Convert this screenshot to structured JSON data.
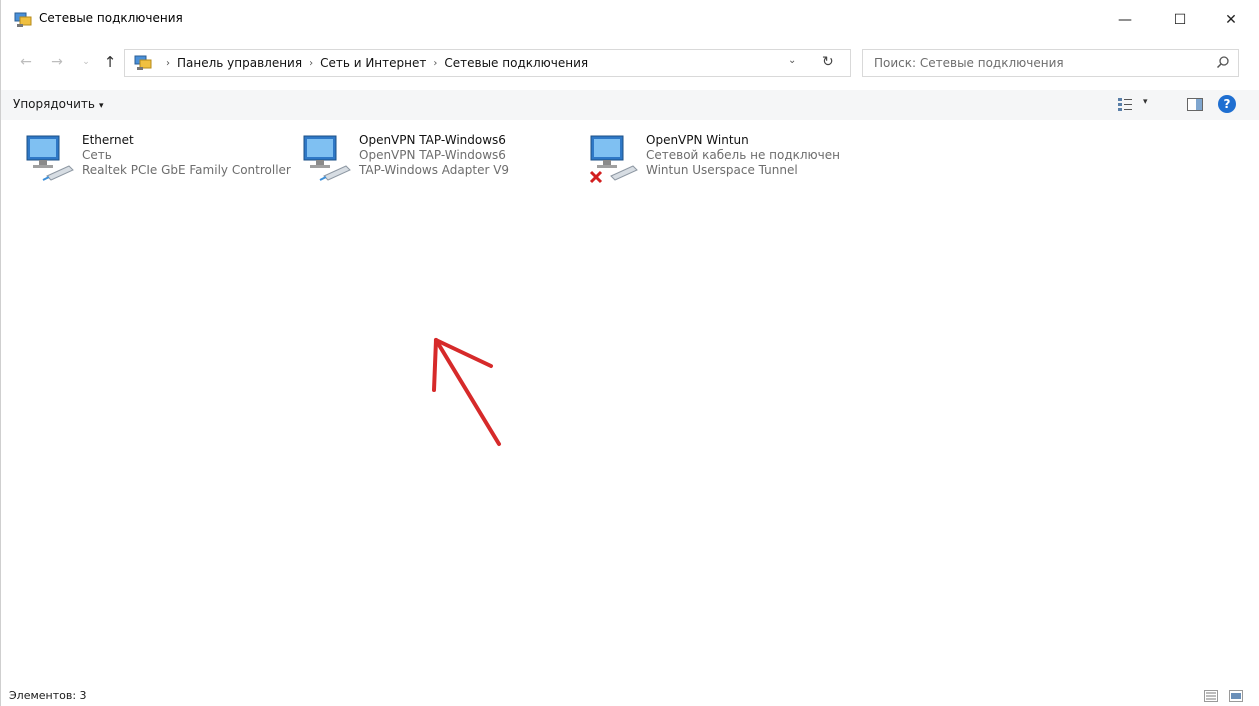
{
  "window": {
    "title": "Сетевые подключения",
    "minimize_glyph": "—",
    "maximize_glyph": "☐",
    "close_glyph": "✕"
  },
  "nav": {
    "back_glyph": "←",
    "forward_glyph": "→",
    "recent_glyph": "⌄",
    "up_glyph": "↑"
  },
  "address": {
    "breadcrumbs": [
      "Панель управления",
      "Сеть и Интернет",
      "Сетевые подключения"
    ],
    "separator_glyph": "›",
    "dropdown_glyph": "⌄",
    "refresh_glyph": "↻"
  },
  "search": {
    "placeholder": "Поиск: Сетевые подключения"
  },
  "command_bar": {
    "organize_label": "Упорядочить",
    "organize_caret": "▾",
    "view_caret": "▾",
    "help_glyph": "?"
  },
  "connections": [
    {
      "name": "Ethernet",
      "status": "Сеть",
      "device": "Realtek PCIe GbE Family Controller",
      "disconnected": false
    },
    {
      "name": "OpenVPN TAP-Windows6",
      "status": "OpenVPN TAP-Windows6",
      "device": "TAP-Windows Adapter V9",
      "disconnected": false
    },
    {
      "name": "OpenVPN Wintun",
      "status": "Сетевой кабель не подключен",
      "device": "Wintun Userspace Tunnel",
      "disconnected": true
    }
  ],
  "status_bar": {
    "count_text": "Элементов: 3"
  },
  "colors": {
    "annotation_arrow": "#d62a2a",
    "help_button": "#1f6fd1",
    "disconnected_x": "#d21f1f"
  }
}
